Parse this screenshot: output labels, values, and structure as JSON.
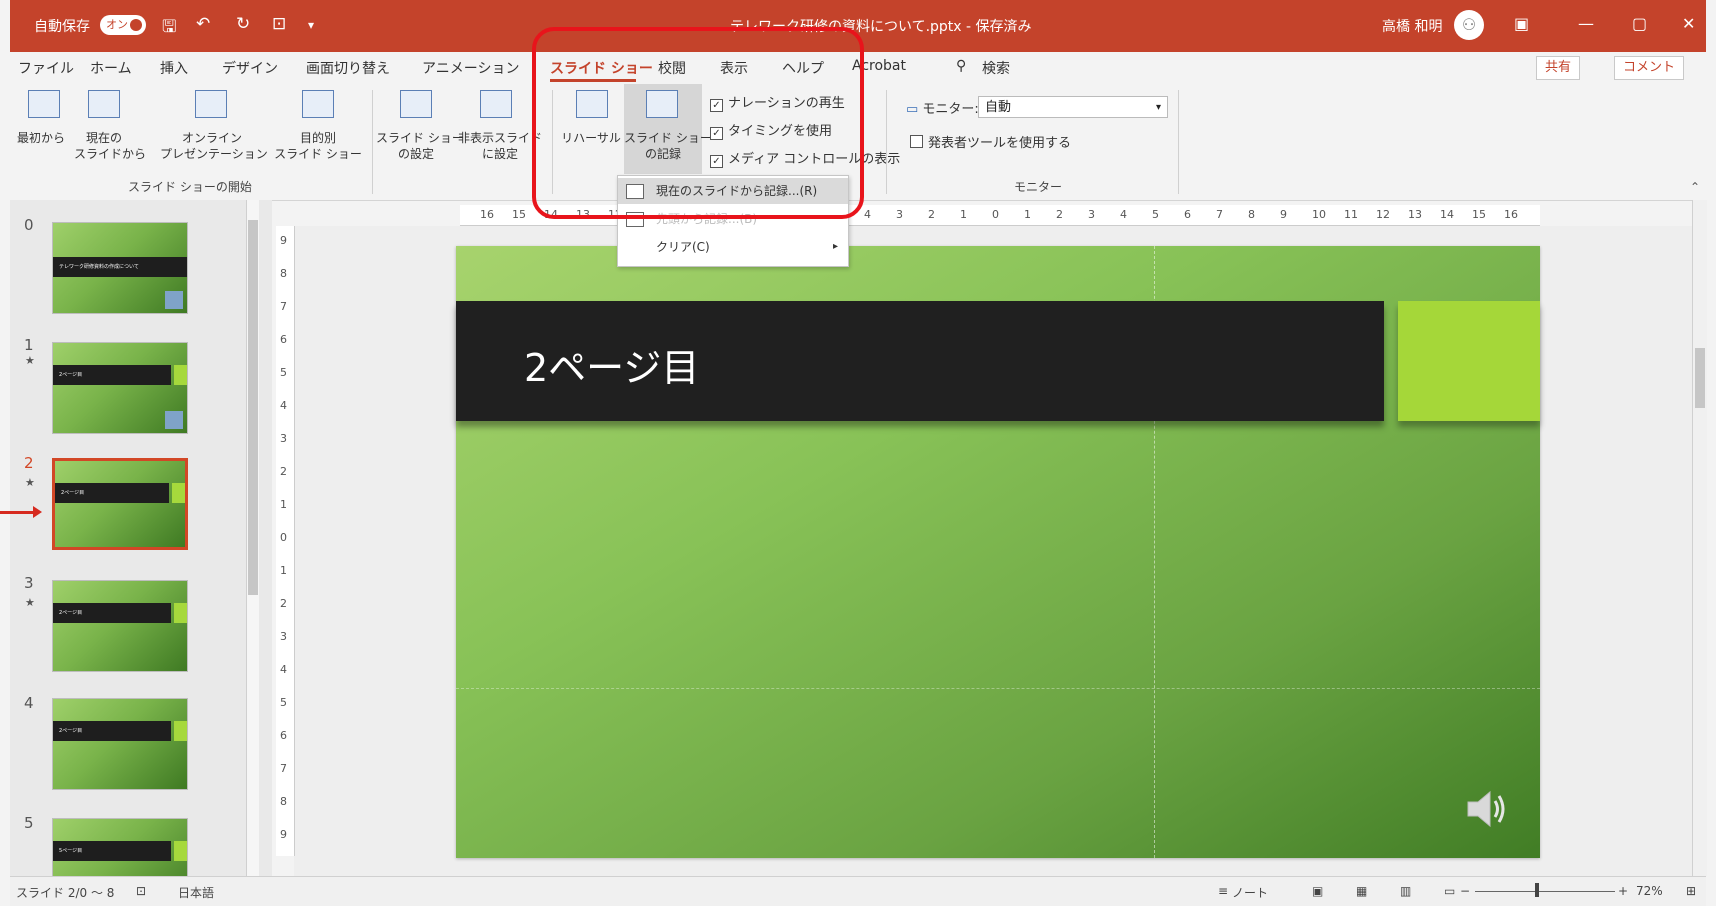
{
  "titlebar": {
    "autosave_label": "自動保存",
    "autosave_state": "オン",
    "doc_title": "テレワーク研修の資料について.pptx - 保存済み",
    "user_name": "高橋 和明",
    "icons": [
      "save-icon",
      "undo-icon",
      "redo-icon",
      "present-icon",
      "customize-icon",
      "avatar-icon",
      "ribbon-display-icon",
      "minimize-icon",
      "maximize-icon",
      "close-icon"
    ]
  },
  "menu": {
    "items": [
      "ファイル",
      "ホーム",
      "挿入",
      "デザイン",
      "画面切り替え",
      "アニメーション",
      "スライド ショー",
      "校閲",
      "表示",
      "ヘルプ",
      "Acrobat"
    ],
    "search": "検索",
    "share": "共有",
    "comment": "コメント"
  },
  "ribbon": {
    "start_group": {
      "from_start": "最初から",
      "from_current": [
        "現在の",
        "スライドから"
      ],
      "online": [
        "オンライン",
        "プレゼンテーション"
      ],
      "custom": [
        "目的別",
        "スライド ショー"
      ],
      "label": "スライド ショーの開始"
    },
    "setup_group": {
      "setup": [
        "スライド ショー",
        "の設定"
      ],
      "hide": [
        "非表示スライド",
        "に設定"
      ],
      "rehearse": "リハーサル",
      "record": [
        "スライド ショー",
        "の記録"
      ],
      "checks": [
        "ナレーションの再生",
        "タイミングを使用",
        "メディア コントロールの表示"
      ]
    },
    "monitor_group": {
      "monitor_label": "モニター:",
      "monitor_value": "自動",
      "presenter_view": "発表者ツールを使用する",
      "label": "モニター"
    }
  },
  "dropdown": {
    "items": [
      "現在のスライドから記録...(R)",
      "先頭から記録...(B)",
      "クリア(C)"
    ]
  },
  "slides": {
    "numbers": [
      "0",
      "1",
      "2",
      "3",
      "4",
      "5"
    ],
    "thumb_titles": [
      "テレワーク研修資料の作成について",
      "2ページ目",
      "2ページ目",
      "2ページ目",
      "2ページ目",
      "5ページ目"
    ],
    "active_index": 2
  },
  "ruler": {
    "h_ticks": [
      "16",
      "15",
      "14",
      "13",
      "12",
      "11",
      "10",
      "9",
      "8",
      "7",
      "6",
      "5",
      "4",
      "3",
      "2",
      "1",
      "0",
      "1",
      "2",
      "3",
      "4",
      "5",
      "6",
      "7",
      "8",
      "9",
      "10",
      "11",
      "12",
      "13",
      "14",
      "15",
      "16"
    ],
    "v_ticks": [
      "9",
      "8",
      "7",
      "6",
      "5",
      "4",
      "3",
      "2",
      "1",
      "0",
      "1",
      "2",
      "3",
      "4",
      "5",
      "6",
      "7",
      "8",
      "9"
    ]
  },
  "slide": {
    "title": "2ページ目"
  },
  "statusbar": {
    "slide_info": "スライド 2/0 ～ 8",
    "language": "日本語",
    "notes": "ノート",
    "zoom": "72%"
  },
  "colors": {
    "accent": "#c4432b",
    "highlight": "#e8141b",
    "slide_bar": "#202020",
    "slide_accent": "#a5d739"
  }
}
